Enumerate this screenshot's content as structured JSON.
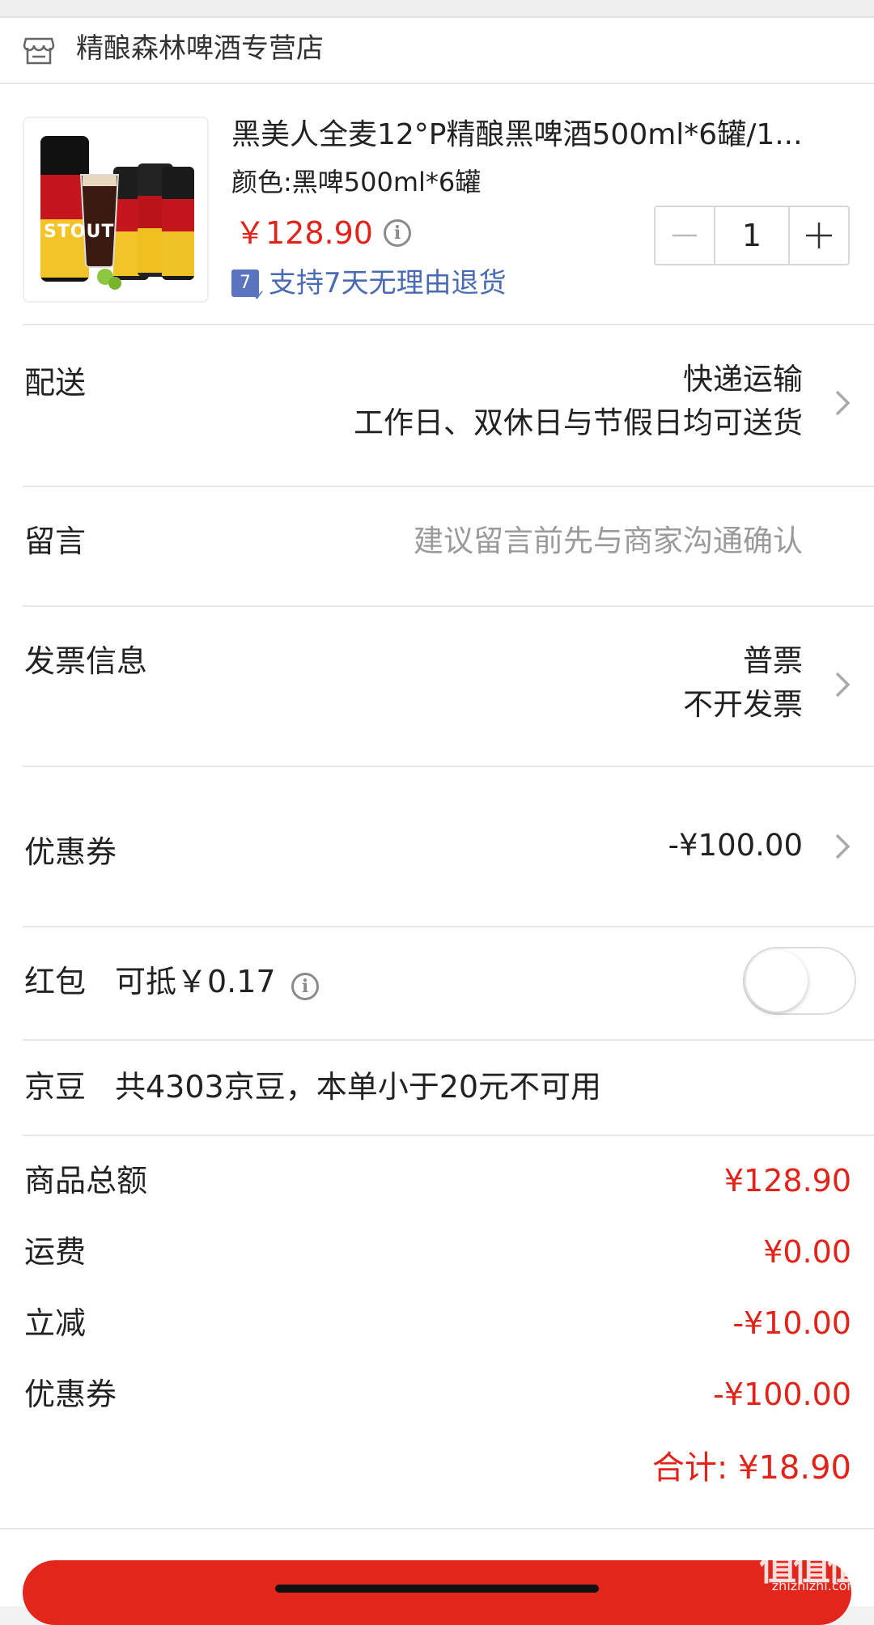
{
  "shop": {
    "name": "精酿森林啤酒专营店",
    "icon": "store-icon"
  },
  "product": {
    "title": "黑美人全麦12°P精酿黑啤酒500ml*6罐/1...",
    "spec": "颜色:黑啤500ml*6罐",
    "price": "￥128.90",
    "quantity": "1",
    "return_badge": "7",
    "return_policy": "支持7天无理由退货",
    "image_text": "STOUT"
  },
  "delivery": {
    "label": "配送",
    "method": "快递运输",
    "schedule": "工作日、双休日与节假日均可送货"
  },
  "message": {
    "label": "留言",
    "placeholder": "建议留言前先与商家沟通确认"
  },
  "invoice": {
    "label": "发票信息",
    "type": "普票",
    "status": "不开发票"
  },
  "coupon": {
    "label": "优惠券",
    "value": "-¥100.00"
  },
  "red_packet": {
    "label": "红包",
    "deductible": "可抵￥0.17",
    "enabled": false
  },
  "jd_beans": {
    "label": "京豆",
    "info": "共4303京豆，本单小于20元不可用"
  },
  "summary": {
    "items_total_label": "商品总额",
    "items_total": "¥128.90",
    "shipping_label": "运费",
    "shipping": "¥0.00",
    "discount_label": "立减",
    "discount": "-¥10.00",
    "coupon_label": "优惠券",
    "coupon": "-¥100.00",
    "total": "合计: ¥18.90"
  },
  "watermark": {
    "main": "值值值",
    "sub": "zhizhizhi.com"
  },
  "colors": {
    "price_red": "#e2231a",
    "link_blue": "#4a6ab3",
    "submit_red": "#e3261b"
  }
}
